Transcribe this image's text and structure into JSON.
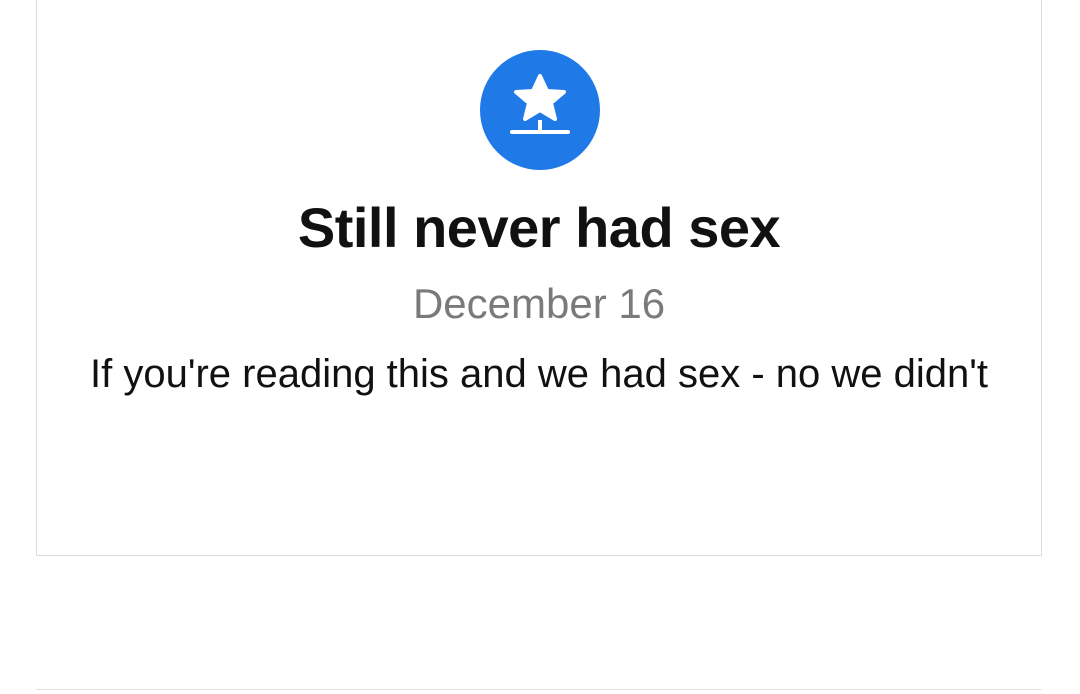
{
  "card": {
    "icon": "star-pin-icon",
    "title": "Still never had sex",
    "date": "December 16",
    "message": "If you're reading this and we had sex - no we didn't"
  },
  "colors": {
    "badge": "#1f7ae8",
    "title": "#111111",
    "date": "#7a7a7a",
    "border": "#dcdcdc"
  }
}
